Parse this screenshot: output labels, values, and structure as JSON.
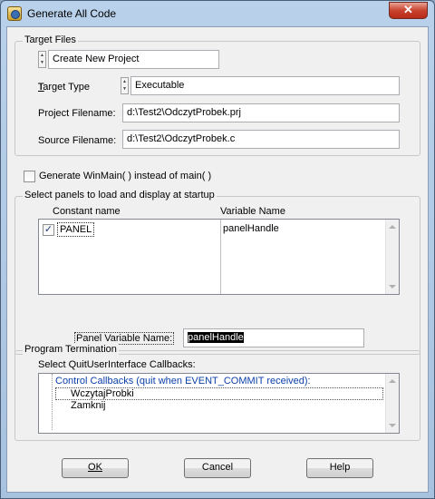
{
  "window": {
    "title": "Generate All Code",
    "close_symbol": "✕"
  },
  "target_files": {
    "legend": "Target Files",
    "project_mode": "Create New Project",
    "target_type_label": "Target Type",
    "target_type_value": "Executable",
    "project_filename_label": "Project Filename:",
    "project_filename_value": "d:\\Test2\\OdczytProbek.prj",
    "source_filename_label": "Source Filename:",
    "source_filename_value": "d:\\Test2\\OdczytProbek.c"
  },
  "winmain": {
    "label": "Generate WinMain( ) instead of main( )",
    "checked": false
  },
  "panels": {
    "legend": "Select panels to load and display at startup",
    "col_constant": "Constant name",
    "col_variable": "Variable Name",
    "rows": [
      {
        "constant": "PANEL",
        "variable": "panelHandle",
        "checked": true
      }
    ],
    "check_mark": "✓",
    "panel_var_label": "Panel Variable Name:",
    "panel_var_value": "panelHandle"
  },
  "termination": {
    "legend": "Program Termination",
    "select_label": "Select QuitUserInterface Callbacks:",
    "header": "Control Callbacks (quit when EVENT_COMMIT received):",
    "items": [
      "WczytajProbki",
      "Zamknij"
    ]
  },
  "buttons": {
    "ok": "OK",
    "cancel": "Cancel",
    "help": "Help"
  },
  "icons": [
    "app-icon",
    "close-icon",
    "spinner-icon",
    "checkbox-icon",
    "scroll-up-icon",
    "scroll-down-icon"
  ],
  "colors": {
    "titlebar": "#b9d1ea",
    "dialog_bg": "#f0f0f0",
    "close": "#c9432e",
    "list_header": "#0b3fa8"
  }
}
